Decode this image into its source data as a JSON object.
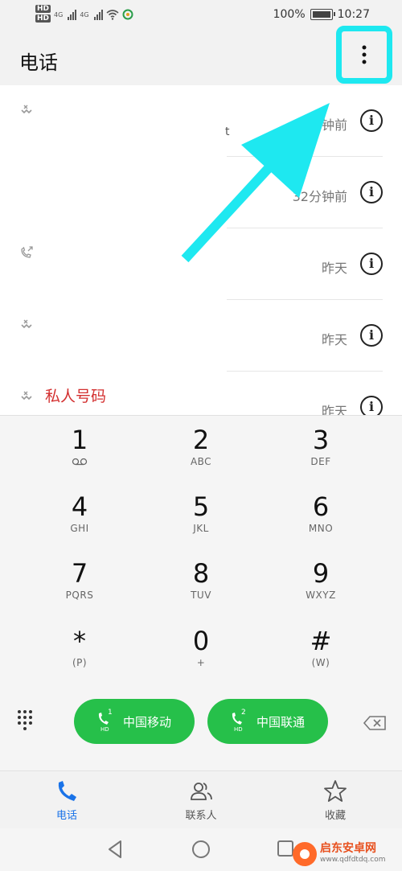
{
  "status_bar": {
    "hd1": "HD",
    "hd2": "HD",
    "net1": "4G",
    "net2": "4G",
    "battery": "100%",
    "time": "10:27"
  },
  "header": {
    "title": "电话",
    "more_icon": "more-vertical-icon"
  },
  "call_log": [
    {
      "name": "",
      "time": "23分钟前",
      "type": "missed-call-icon",
      "fragment": "t"
    },
    {
      "name": "",
      "time": "32分钟前",
      "type": ""
    },
    {
      "name": "",
      "time": "昨天",
      "type": "outgoing-call-icon"
    },
    {
      "name": "",
      "time": "昨天",
      "type": "missed-call-icon"
    },
    {
      "name": "私人号码",
      "time": "昨天",
      "type": "missed-call-icon"
    }
  ],
  "dialpad": {
    "keys": [
      {
        "digit": "1",
        "letters": ""
      },
      {
        "digit": "2",
        "letters": "ABC"
      },
      {
        "digit": "3",
        "letters": "DEF"
      },
      {
        "digit": "4",
        "letters": "GHI"
      },
      {
        "digit": "5",
        "letters": "JKL"
      },
      {
        "digit": "6",
        "letters": "MNO"
      },
      {
        "digit": "7",
        "letters": "PQRS"
      },
      {
        "digit": "8",
        "letters": "TUV"
      },
      {
        "digit": "9",
        "letters": "WXYZ"
      },
      {
        "digit": "*",
        "letters": "(P)"
      },
      {
        "digit": "0",
        "letters": "+"
      },
      {
        "digit": "#",
        "letters": "(W)"
      }
    ],
    "sim1": {
      "label": "中国移动",
      "num": "1",
      "hd": "HD"
    },
    "sim2": {
      "label": "中国联通",
      "num": "2",
      "hd": "HD"
    }
  },
  "bottom_nav": {
    "phone": "电话",
    "contacts": "联系人",
    "favorites": "收藏"
  },
  "watermark": {
    "name": "启东安卓网",
    "url": "www.qdfdtdq.com"
  },
  "colors": {
    "highlight": "#1ee8f0",
    "call_green": "#26c04a",
    "active_blue": "#1a73e8",
    "missed_red": "#d32f2f"
  }
}
